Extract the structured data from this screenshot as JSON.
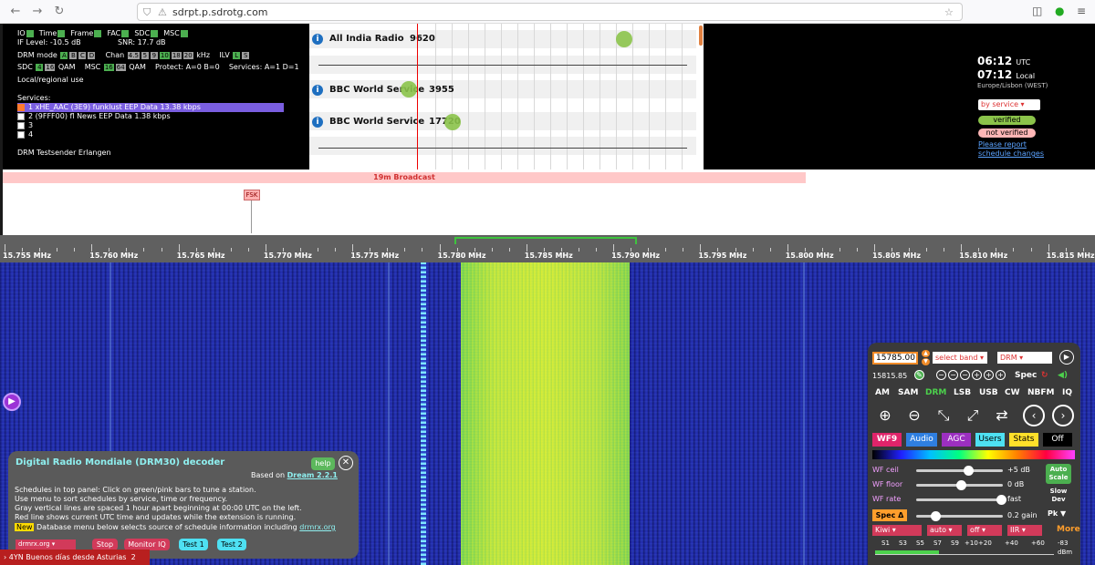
{
  "browser": {
    "url": "sdrpt.p.sdrotg.com",
    "back_icon": "arrow-left-icon",
    "forward_icon": "arrow-right-icon",
    "reload_icon": "reload-icon"
  },
  "drm_status": {
    "row1": [
      "IO",
      "Time",
      "Frame",
      "FAC",
      "SDC",
      "MSC"
    ],
    "if_level": "IF Level: -10.5 dB",
    "snr": "SNR: 17.7 dB",
    "drm_mode_label": "DRM mode",
    "drm_modes": [
      "A",
      "B",
      "C",
      "D"
    ],
    "chan_label": "Chan",
    "chan_values": [
      "4.5",
      "5",
      "9",
      "10",
      "18",
      "20"
    ],
    "chan_unit": "kHz",
    "ilv_label": "ILV",
    "ilv_values": [
      "L",
      "S"
    ],
    "sdc_label": "SDC",
    "sdc_values": [
      "4",
      "16"
    ],
    "sdc_unit": "QAM",
    "msc_label": "MSC",
    "msc_values": [
      "16",
      "64"
    ],
    "msc_unit": "QAM",
    "protect": "Protect: A=0 B=0",
    "services_count": "Services: A=1 D=1",
    "local_use": "Local/regional use",
    "services_heading": "Services:",
    "services": [
      {
        "label": "1 xHE_AAC (3E9) funklust EEP Data 13.38 kbps",
        "checked": true
      },
      {
        "label": "2 (9FFF00) fl News EEP Data 1.38 kbps",
        "checked": false
      },
      {
        "label": "3",
        "checked": false
      },
      {
        "label": "4",
        "checked": false
      }
    ],
    "station_name": "DRM Testsender Erlangen"
  },
  "schedule": {
    "rows": [
      {
        "name": "All India Radio",
        "freq": "9620"
      },
      {
        "name": "BBC World Service",
        "freq": "3955"
      },
      {
        "name": "BBC World Service",
        "freq": "17720"
      }
    ]
  },
  "right_panel": {
    "utc_time": "06:12",
    "utc_label": "UTC",
    "local_time": "07:12",
    "local_label": "Local",
    "timezone": "Europe/Lisbon (WEST)",
    "sort_select": "by service",
    "verified": "verified",
    "not_verified": "not verified",
    "report_line1": "Please report",
    "report_line2": "schedule changes"
  },
  "band": {
    "label": "19m Broadcast",
    "marker": "FSK"
  },
  "scale": {
    "labels": [
      "15.755 MHz",
      "15.760 MHz",
      "15.765 MHz",
      "15.770 MHz",
      "15.775 MHz",
      "15.780 MHz",
      "15.785 MHz",
      "15.790 MHz",
      "15.795 MHz",
      "15.800 MHz",
      "15.805 MHz",
      "15.810 MHz",
      "15.815 MHz"
    ]
  },
  "decoder": {
    "title": "Digital Radio Mondiale (DRM30) decoder",
    "help": "help",
    "based_on": "Based on",
    "based_link": "Dream 2.2.1",
    "lines": [
      "Schedules in top panel: Click on green/pink bars to tune a station.",
      "Use menu to sort schedules by service, time or frequency.",
      "Gray vertical lines are spaced 1 hour apart beginning at 00:00 UTC on the left.",
      "Red line shows current UTC time and updates while the extension is running."
    ],
    "new_tag": "New",
    "new_text": "Database menu below selects source of schedule information including",
    "new_link": "drmrx.org",
    "db_select": "drmrx.org",
    "stop": "Stop",
    "monitor": "Monitor IQ",
    "test1": "Test 1",
    "test2": "Test 2"
  },
  "status_bar": {
    "text": "4YN Buenos días desde Asturias",
    "count": "2"
  },
  "controls": {
    "frequency": "15785.00",
    "band_select": "select band",
    "mode_select": "DRM",
    "sub_freq": "15815.85",
    "spec": "Spec",
    "modes": [
      "AM",
      "SAM",
      "DRM",
      "LSB",
      "USB",
      "CW",
      "NBFM",
      "IQ"
    ],
    "active_mode": "DRM",
    "tabs": [
      "WF9",
      "Audio",
      "AGC",
      "Users",
      "Stats",
      "Off"
    ],
    "wf_ceil_label": "WF ceil",
    "wf_ceil_value": "+5 dB",
    "wf_ceil_level": 0.6,
    "wf_floor_label": "WF floor",
    "wf_floor_value": "0 dB",
    "wf_floor_level": 0.52,
    "wf_rate_label": "WF rate",
    "wf_rate_value": "fast",
    "wf_rate_level": 0.98,
    "spec_delta": "Spec Δ",
    "gain_value": "0.2 gain",
    "gain_level": 0.22,
    "auto_scale_1": "Auto",
    "auto_scale_2": "Scale",
    "slow_dev_1": "Slow",
    "slow_dev_2": "Dev",
    "pk": "Pk",
    "dd1": "Kiwi",
    "dd2": "auto",
    "dd3": "off",
    "dd4": "IIR",
    "more": "More",
    "smeter_labels": [
      "S1",
      "S3",
      "S5",
      "S7",
      "S9",
      "+10",
      "+20",
      "+40",
      "+60",
      "-83"
    ],
    "smeter_unit": "dBm"
  }
}
